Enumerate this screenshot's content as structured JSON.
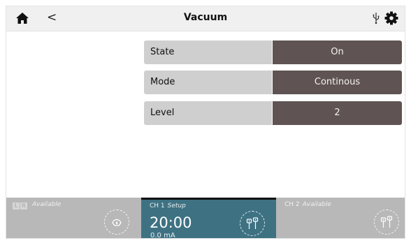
{
  "header": {
    "title": "Vacuum",
    "home_icon": "home-icon",
    "back_icon": "chevron-left-icon",
    "back_glyph": "<",
    "usb_icon": "usb-icon",
    "settings_icon": "gear-icon"
  },
  "settings": [
    {
      "label": "State",
      "value": "On"
    },
    {
      "label": "Mode",
      "value": "Continous"
    },
    {
      "label": "Level",
      "value": "2"
    }
  ],
  "channels": {
    "left": {
      "l_badge": "L",
      "r_badge": "R",
      "status": "Available",
      "icon": "suction-cup-icon"
    },
    "ch1": {
      "name": "CH 1",
      "status": "Setup",
      "timer": "20:00",
      "current": "0.0 mA",
      "icon": "electrodes-icon"
    },
    "ch2": {
      "name": "CH 2",
      "status": "Available",
      "icon": "electrodes-icon"
    }
  },
  "colors": {
    "header_bg": "#f0f0f0",
    "label_bg": "#cfcfcf",
    "value_bg": "#5f5453",
    "channel_active": "#3e7283",
    "channel_inactive": "#b8b8b8"
  }
}
